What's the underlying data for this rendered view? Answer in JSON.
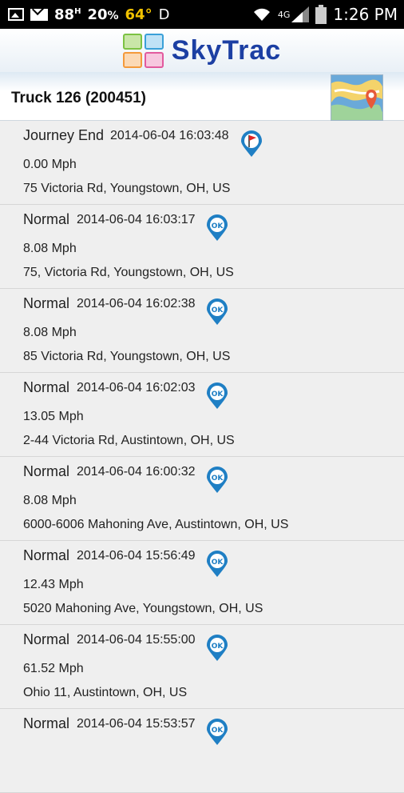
{
  "status_bar": {
    "battery_text": "88",
    "percent_text": "20",
    "temperature": "64°",
    "network": "4G",
    "time": "1:26 PM"
  },
  "header": {
    "brand": "SkyTrac"
  },
  "vehicle": {
    "title": "Truck 126 (200451)"
  },
  "events": [
    {
      "status": "Journey End",
      "timestamp": "2014-06-04 16:03:48",
      "speed": "0.00 Mph",
      "address": "75 Victoria Rd, Youngstown, OH, US",
      "icon": "flag-pin-icon"
    },
    {
      "status": "Normal",
      "timestamp": "2014-06-04 16:03:17",
      "speed": "8.08 Mph",
      "address": "75, Victoria Rd, Youngstown, OH, US",
      "icon": "ok-pin-icon"
    },
    {
      "status": "Normal",
      "timestamp": "2014-06-04 16:02:38",
      "speed": "8.08 Mph",
      "address": "85 Victoria Rd, Youngstown, OH, US",
      "icon": "ok-pin-icon"
    },
    {
      "status": "Normal",
      "timestamp": "2014-06-04 16:02:03",
      "speed": "13.05 Mph",
      "address": "2-44 Victoria Rd, Austintown, OH, US",
      "icon": "ok-pin-icon"
    },
    {
      "status": "Normal",
      "timestamp": "2014-06-04 16:00:32",
      "speed": "8.08 Mph",
      "address": "6000-6006 Mahoning Ave, Austintown, OH, US",
      "icon": "ok-pin-icon"
    },
    {
      "status": "Normal",
      "timestamp": "2014-06-04 15:56:49",
      "speed": "12.43 Mph",
      "address": "5020 Mahoning Ave, Youngstown, OH, US",
      "icon": "ok-pin-icon"
    },
    {
      "status": "Normal",
      "timestamp": "2014-06-04 15:55:00",
      "speed": "61.52 Mph",
      "address": "Ohio 11, Austintown, OH, US",
      "icon": "ok-pin-icon"
    },
    {
      "status": "Normal",
      "timestamp": "2014-06-04 15:53:57",
      "speed": "",
      "address": "",
      "icon": "ok-pin-icon"
    }
  ],
  "colors": {
    "brand": "#1c3fa3",
    "pin": "#1f7fc4",
    "flag": "#e02424"
  }
}
